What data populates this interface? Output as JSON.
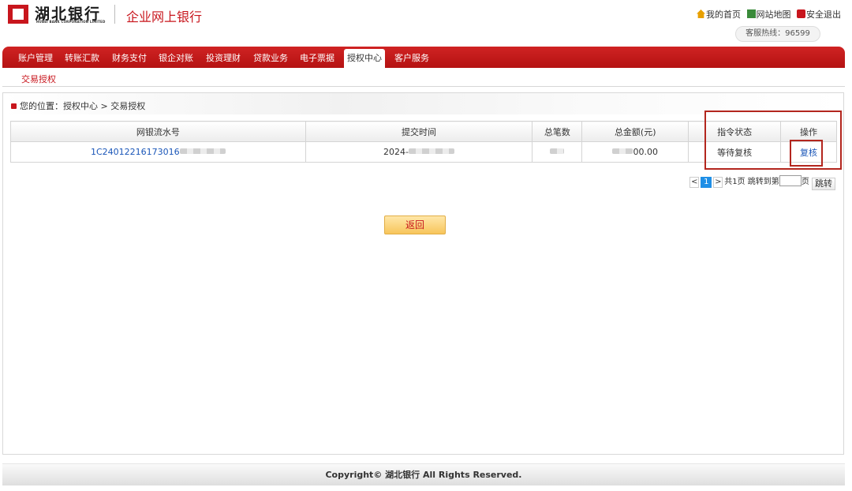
{
  "header": {
    "bank_name_cn": "湖北银行",
    "bank_name_en": "HUBEI BANK CORPORATION LIMITED",
    "subtitle": "企业网上银行",
    "links": {
      "home": "我的首页",
      "sitemap": "网站地图",
      "logout": "安全退出"
    },
    "hotline": "客服热线：96599"
  },
  "nav": {
    "items": [
      "账户管理",
      "转账汇款",
      "财务支付",
      "银企对账",
      "投资理财",
      "贷款业务",
      "电子票据",
      "授权中心",
      "客户服务"
    ],
    "active": "授权中心"
  },
  "subnav": {
    "items": [
      "交易授权"
    ]
  },
  "breadcrumb": "您的位置：授权中心 > 交易授权",
  "table": {
    "headers": [
      "网银流水号",
      "提交时间",
      "总笔数",
      "总金额(元)",
      "指令状态",
      "操作"
    ],
    "rows": [
      {
        "serial": "1C24012216173016",
        "time": "2024-",
        "count": "",
        "amount_suffix": "00.00",
        "status": "等待复核",
        "action": "复核"
      }
    ]
  },
  "pagination": {
    "prev": "<",
    "current": "1",
    "next": ">",
    "summary": "共1页 跳转到第",
    "page_suffix": "页",
    "go": "跳转"
  },
  "buttons": {
    "back": "返回"
  },
  "footer": "Copyright© 湖北银行 All Rights Reserved."
}
